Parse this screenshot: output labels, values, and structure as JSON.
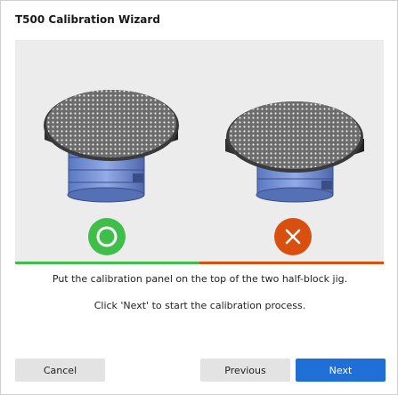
{
  "window": {
    "title": "T500 Calibration Wizard"
  },
  "illustration": {
    "correct": {
      "icon": "circle-ok-icon",
      "color": "#3fbf4a"
    },
    "incorrect": {
      "icon": "x-icon",
      "color": "#d94f0f"
    }
  },
  "instructions": {
    "line1": "Put the calibration panel on the top of the two half-block jig.",
    "line2": "Click 'Next' to start the calibration process."
  },
  "buttons": {
    "cancel": "Cancel",
    "previous": "Previous",
    "next": "Next"
  },
  "colors": {
    "accent": "#1f6fd6",
    "good": "#3fbf4a",
    "bad": "#d94f0f"
  }
}
